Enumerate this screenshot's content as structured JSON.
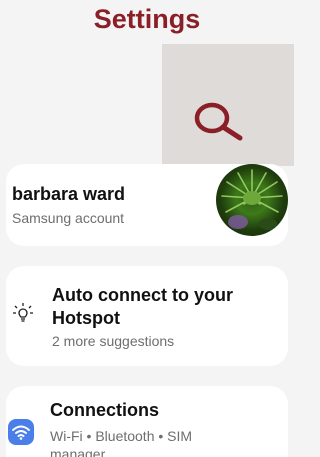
{
  "header": {
    "title": "Settings"
  },
  "search": {
    "icon": "search-icon"
  },
  "account": {
    "name": "barbara ward",
    "subtitle": "Samsung account",
    "avatar_icon": "avatar-photo"
  },
  "suggestion": {
    "title": "Auto connect to your Hotspot",
    "subtitle": "2 more suggestions",
    "icon": "lightbulb-icon"
  },
  "connections": {
    "title": "Connections",
    "subtitle": "Wi-Fi • Bluetooth • SIM manager",
    "icon": "wifi-icon"
  },
  "colors": {
    "title": "#8a1f27",
    "background": "#f4f4f4",
    "card": "#ffffff",
    "connections_icon": "#4a7ee8",
    "secondary_text": "#6e6e6e"
  }
}
